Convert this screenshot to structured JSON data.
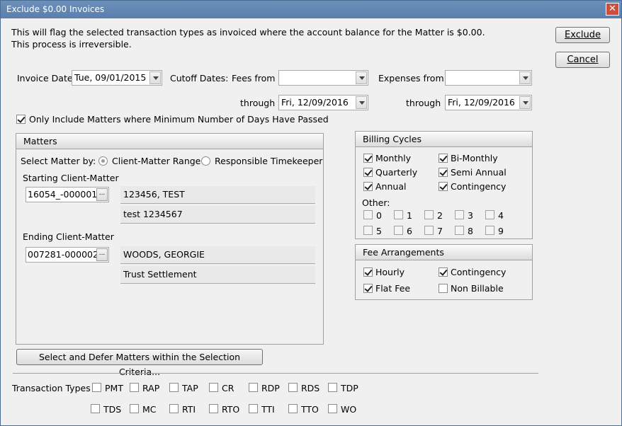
{
  "window": {
    "title": "Exclude $0.00 Invoices",
    "close_glyph": "✕"
  },
  "intro": {
    "line1": "This will flag the selected transaction types as invoiced where the account balance for the Matter is $0.00.",
    "line2": "This process is irreversible."
  },
  "buttons": {
    "exclude": "Exclude",
    "cancel": "Cancel",
    "select_defer": "Select and Defer Matters within the Selection Criteria..."
  },
  "dates": {
    "invoice_date_label": "Invoice Date",
    "invoice_date_value": "Tue, 09/01/2015",
    "cutoff_label": "Cutoff Dates:",
    "fees_from_label": "Fees from",
    "fees_from_value": "",
    "expenses_from_label": "Expenses from",
    "expenses_from_value": "",
    "through_label": "through",
    "fees_through_value": "Fri, 12/09/2016",
    "expenses_through_value": "Fri, 12/09/2016"
  },
  "min_days": {
    "label": "Only Include Matters where Minimum Number of Days Have Passed",
    "checked": true
  },
  "matters": {
    "title": "Matters",
    "select_by_label": "Select Matter by:",
    "option_range": "Client-Matter Range",
    "option_timekeeper": "Responsible Timekeeper",
    "starting_label": "Starting Client-Matter",
    "starting_value": "16054_-000001",
    "starting_client": "123456, TEST",
    "starting_matter": "test 1234567",
    "ending_label": "Ending Client-Matter",
    "ending_value": "007281-000002",
    "ending_client": "WOODS, GEORGIE",
    "ending_matter": "Trust Settlement",
    "ellipsis": "..."
  },
  "billing_cycles": {
    "title": "Billing Cycles",
    "items": [
      {
        "label": "Monthly",
        "checked": true
      },
      {
        "label": "Bi-Monthly",
        "checked": true
      },
      {
        "label": "Quarterly",
        "checked": true
      },
      {
        "label": "Semi Annual",
        "checked": true
      },
      {
        "label": "Annual",
        "checked": true
      },
      {
        "label": "Contingency",
        "checked": true
      }
    ],
    "other_label": "Other:",
    "other": [
      "0",
      "1",
      "2",
      "3",
      "4",
      "5",
      "6",
      "7",
      "8",
      "9"
    ]
  },
  "fee_arrangements": {
    "title": "Fee Arrangements",
    "items": [
      {
        "label": "Hourly",
        "checked": true
      },
      {
        "label": "Contingency",
        "checked": true
      },
      {
        "label": "Flat Fee",
        "checked": true
      },
      {
        "label": "Non Billable",
        "checked": false
      }
    ]
  },
  "transaction_types": {
    "label": "Transaction Types",
    "row1": [
      "PMT",
      "RAP",
      "TAP",
      "CR",
      "RDP",
      "RDS",
      "TDP"
    ],
    "row2": [
      "TDS",
      "MC",
      "RTI",
      "RTO",
      "TTI",
      "TTO",
      "WO"
    ]
  }
}
